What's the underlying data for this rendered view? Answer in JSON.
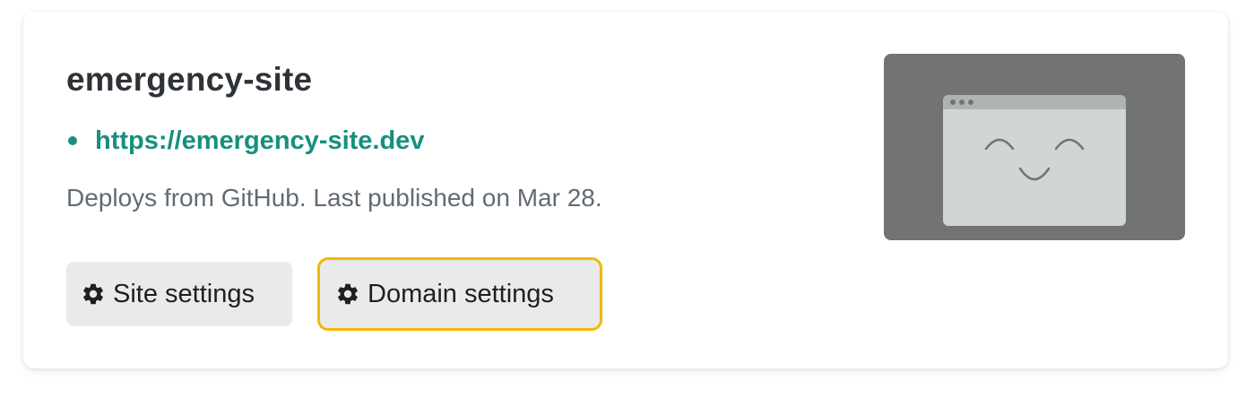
{
  "site": {
    "name": "emergency-site",
    "url": "https://emergency-site.dev",
    "deploy_info": "Deploys from GitHub. Last published on Mar 28.",
    "status_color": "#16907c"
  },
  "actions": {
    "site_settings_label": "Site settings",
    "domain_settings_label": "Domain settings",
    "icon": "gear-icon",
    "focused": "domain_settings",
    "focus_color": "#f2b705"
  },
  "thumbnail": {
    "icon": "smiling-browser-icon"
  }
}
